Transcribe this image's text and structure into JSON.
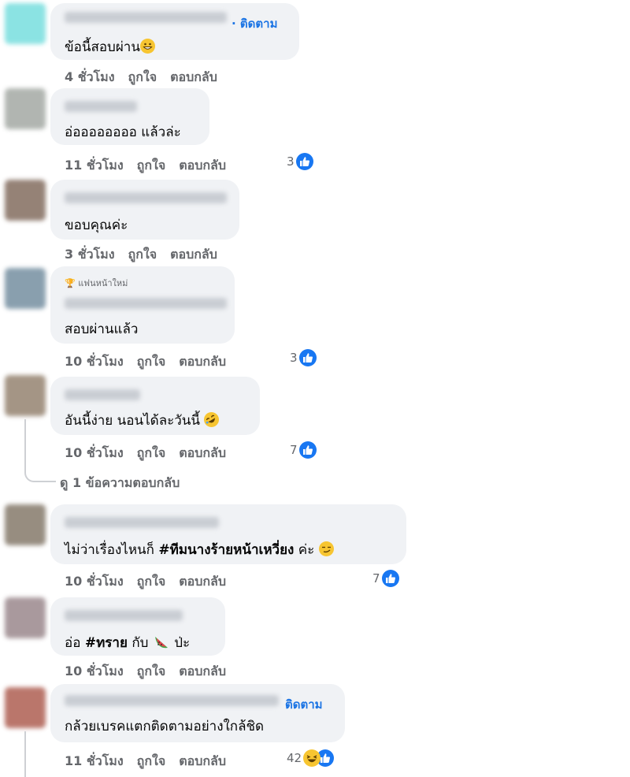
{
  "comments": [
    {
      "text": "ข้อนี้สอบผ่าน",
      "follow": "· ติดตาม",
      "time": "4 ชั่วโมง",
      "like": "ถูกใจ",
      "reply": "ตอบกลับ",
      "reactions": null,
      "emoji": "grinning-face-icon",
      "avatar_color": "#7fe0e0"
    },
    {
      "text": "อ่ออออออออ แล้วล่ะ",
      "time": "11 ชั่วโมง",
      "like": "ถูกใจ",
      "reply": "ตอบกลับ",
      "reactions": "3",
      "avatar_color": "#a9aea9"
    },
    {
      "text": "ขอบคุณค่ะ",
      "time": "3 ชั่วโมง",
      "like": "ถูกใจ",
      "reply": "ตอบกลับ",
      "reactions": null,
      "avatar_color": "#8a7568"
    },
    {
      "badge": "แฟนหน้าใหม่",
      "text": "สอบผ่านแล้ว",
      "time": "10 ชั่วโมง",
      "like": "ถูกใจ",
      "reply": "ตอบกลับ",
      "reactions": "3",
      "avatar_color": "#7d95a6"
    },
    {
      "text": "อันนี้ง่าย นอนได้ละวันนี้",
      "time": "10 ชั่วโมง",
      "like": "ถูกใจ",
      "reply": "ตอบกลับ",
      "reactions": "7",
      "emoji": "rolling-on-floor-laughing-icon",
      "avatar_color": "#9b8a78"
    },
    {
      "text_before": "ไม่ว่าเรื่องไหนก็ ",
      "hashtag": "#ทีมนางร้ายหน้าเหวี่ยง",
      "text_after": " ค่ะ",
      "time": "10 ชั่วโมง",
      "like": "ถูกใจ",
      "reply": "ตอบกลับ",
      "reactions": "7",
      "emoji": "smirking-face-icon",
      "avatar_color": "#8c8173"
    },
    {
      "text_before": "อ่อ ",
      "hashtag": "#ทราย",
      "text_mid": " กับ ",
      "text_after": " ป่ะ",
      "time": "10 ชั่วโมง",
      "like": "ถูกใจ",
      "reply": "ตอบกลับ",
      "reactions": null,
      "emoji": "watermelon-icon",
      "avatar_color": "#a08f93"
    },
    {
      "text": "กล้วยเบรคแตกติดตามอย่างใกล้ชิด",
      "follow": "ติดตาม",
      "time": "11 ชั่วโมง",
      "like": "ถูกใจ",
      "reply": "ตอบกลับ",
      "reactions": "42",
      "avatar_color": "#b3685c"
    }
  ],
  "view_replies": "ดู 1 ข้อความตอบกลับ",
  "colors": {
    "bubble": "#f0f2f5",
    "meta": "#65676b",
    "link": "#1b74e4",
    "like": "#1877f2",
    "emoji": "#f7c531"
  }
}
